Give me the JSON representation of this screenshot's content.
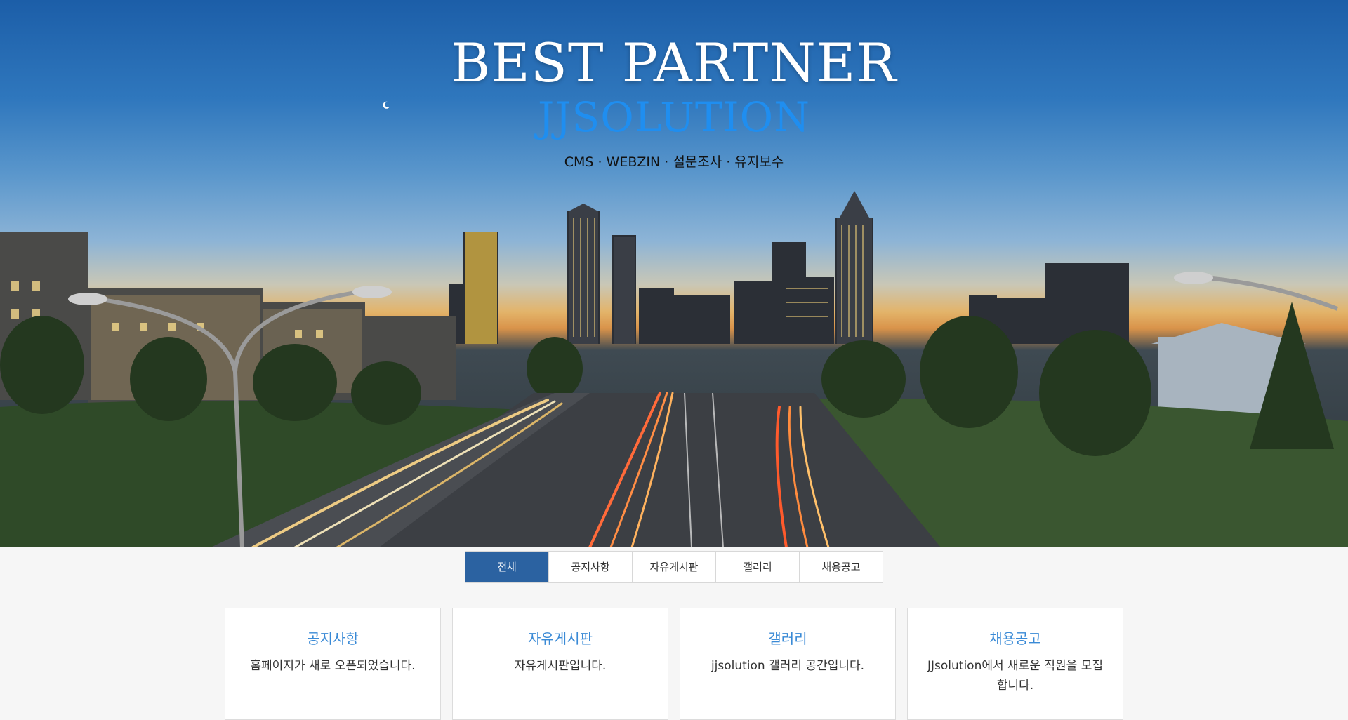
{
  "hero": {
    "title": "BEST PARTNER",
    "brand": "JJSOLUTION",
    "subtitle": "CMS · WEBZIN · 설문조사 · 유지보수",
    "image": "city-highway-night-skyline"
  },
  "tabs": [
    {
      "label": "전체",
      "active": true
    },
    {
      "label": "공지사항",
      "active": false
    },
    {
      "label": "자유게시판",
      "active": false
    },
    {
      "label": "갤러리",
      "active": false
    },
    {
      "label": "채용공고",
      "active": false
    }
  ],
  "cards": [
    {
      "title": "공지사항",
      "desc": "홈페이지가 새로 오픈되었습니다."
    },
    {
      "title": "자유게시판",
      "desc": "자유게시판입니다."
    },
    {
      "title": "갤러리",
      "desc": "jjsolution 갤러리 공간입니다."
    },
    {
      "title": "채용공고",
      "desc": "JJsolution에서 새로운 직원을 모집합니다."
    }
  ],
  "colors": {
    "accent": "#2b62a1",
    "card_title": "#3a8ad6",
    "brand": "#1f8ef0"
  }
}
